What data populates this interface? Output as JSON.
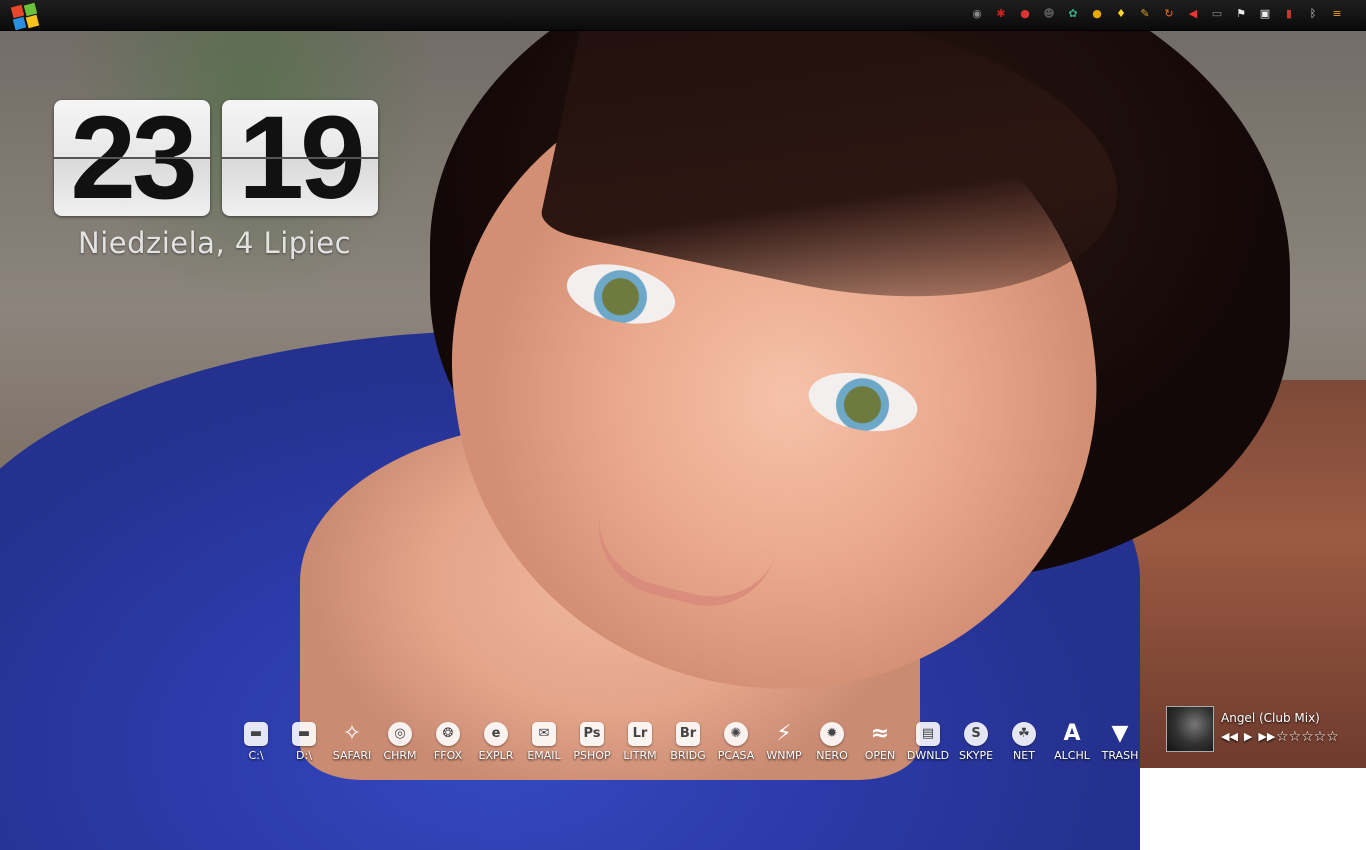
{
  "clock": {
    "hours": "23",
    "minutes": "19",
    "date": "Niedziela, 4 Lipiec"
  },
  "tray": {
    "icons": [
      {
        "name": "disc-icon",
        "glyph": "◉",
        "color": "#8a8a8a"
      },
      {
        "name": "antivirus-icon",
        "glyph": "✱",
        "color": "#c22"
      },
      {
        "name": "record-icon",
        "glyph": "●",
        "color": "#d33"
      },
      {
        "name": "user-group-icon",
        "glyph": "☻",
        "color": "#555"
      },
      {
        "name": "leaf-icon",
        "glyph": "✿",
        "color": "#3a8"
      },
      {
        "name": "coin-icon",
        "glyph": "●",
        "color": "#e8a600"
      },
      {
        "name": "lightbulb-icon",
        "glyph": "♦",
        "color": "#f6d43b"
      },
      {
        "name": "pencil-icon",
        "glyph": "✎",
        "color": "#d8a12c"
      },
      {
        "name": "update-icon",
        "glyph": "↻",
        "color": "#f26a1b"
      },
      {
        "name": "volume-icon",
        "glyph": "◀",
        "color": "#e33"
      },
      {
        "name": "display-icon",
        "glyph": "▭",
        "color": "#888"
      },
      {
        "name": "flag-icon",
        "glyph": "⚑",
        "color": "#eee"
      },
      {
        "name": "usb-icon",
        "glyph": "▣",
        "color": "#eee"
      },
      {
        "name": "network-signal-icon",
        "glyph": "▮",
        "color": "#c33"
      },
      {
        "name": "bluetooth-icon",
        "glyph": "ᛒ",
        "color": "#ddd"
      },
      {
        "name": "menu-icon",
        "glyph": "≡",
        "color": "#f39a1a"
      }
    ]
  },
  "dock": {
    "items": [
      {
        "name": "drive-c",
        "label": "C:\\",
        "glyph": "▬"
      },
      {
        "name": "drive-d",
        "label": "D:\\",
        "glyph": "▬"
      },
      {
        "name": "safari",
        "label": "SAFARI",
        "glyph": "✧"
      },
      {
        "name": "chrome",
        "label": "CHRM",
        "glyph": "◎"
      },
      {
        "name": "firefox",
        "label": "FFOX",
        "glyph": "❂"
      },
      {
        "name": "explorer",
        "label": "EXPLR",
        "glyph": "e"
      },
      {
        "name": "email",
        "label": "EMAIL",
        "glyph": "✉"
      },
      {
        "name": "photoshop",
        "label": "PSHOP",
        "glyph": "Ps"
      },
      {
        "name": "lightroom",
        "label": "LITRM",
        "glyph": "Lr"
      },
      {
        "name": "bridge",
        "label": "BRIDG",
        "glyph": "Br"
      },
      {
        "name": "picasa",
        "label": "PCASA",
        "glyph": "✺"
      },
      {
        "name": "winamp",
        "label": "WNMP",
        "glyph": "⚡"
      },
      {
        "name": "nero",
        "label": "NERO",
        "glyph": "✹"
      },
      {
        "name": "openoffice",
        "label": "OPEN",
        "glyph": "≈"
      },
      {
        "name": "downloads",
        "label": "DWNLD",
        "glyph": "▤"
      },
      {
        "name": "skype",
        "label": "SKYPE",
        "glyph": "S"
      },
      {
        "name": "network",
        "label": "NET",
        "glyph": "☘"
      },
      {
        "name": "alcohol",
        "label": "ALCHL",
        "glyph": "A"
      },
      {
        "name": "trash",
        "label": "TRASH",
        "glyph": "▼"
      }
    ]
  },
  "music": {
    "title": "Angel (Club Mix)",
    "prev": "◀◀",
    "play": "▶",
    "next": "▶▶",
    "rating": "☆☆☆☆☆"
  }
}
